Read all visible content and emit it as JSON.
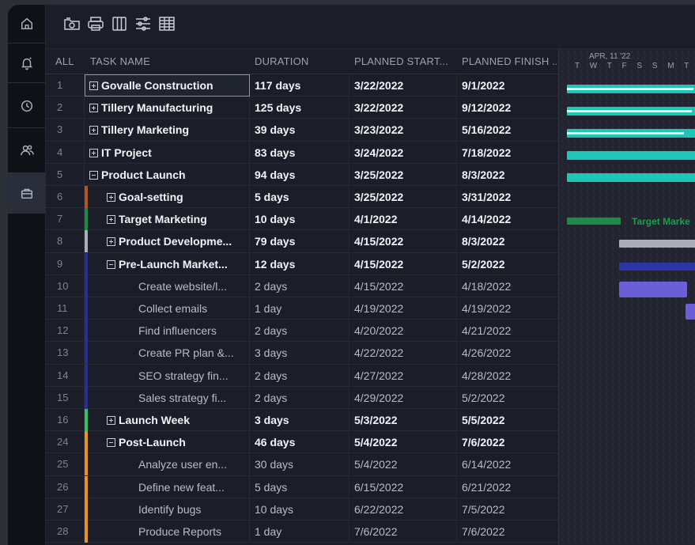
{
  "toolbar": {
    "icons": [
      "folder-image-icon",
      "print-icon",
      "columns-icon",
      "filter-sliders-icon",
      "table-grid-icon"
    ]
  },
  "sidebar": {
    "items": [
      "home-icon",
      "notification-bell-icon",
      "clock-icon",
      "team-icon",
      "briefcase-icon"
    ]
  },
  "columns": {
    "all": "ALL",
    "task": "TASK NAME",
    "duration": "DURATION",
    "start": "PLANNED START...",
    "finish": "PLANNED FINISH ..."
  },
  "gantt": {
    "week_label": "APR, 11 '22",
    "days": "T W T F S S M T",
    "bar_label": "Target Marke"
  },
  "rows": [
    {
      "num": "1",
      "name": "Govalle Construction",
      "duration": "117 days",
      "start": "3/22/2022",
      "finish": "9/1/2022",
      "bold": true,
      "toggle": "plus",
      "indent": 0,
      "color": "",
      "selected": true
    },
    {
      "num": "2",
      "name": "Tillery Manufacturing",
      "duration": "125 days",
      "start": "3/22/2022",
      "finish": "9/12/2022",
      "bold": true,
      "toggle": "plus",
      "indent": 0,
      "color": ""
    },
    {
      "num": "3",
      "name": "Tillery Marketing",
      "duration": "39 days",
      "start": "3/23/2022",
      "finish": "5/16/2022",
      "bold": true,
      "toggle": "plus",
      "indent": 0,
      "color": ""
    },
    {
      "num": "4",
      "name": "IT Project",
      "duration": "83 days",
      "start": "3/24/2022",
      "finish": "7/18/2022",
      "bold": true,
      "toggle": "plus",
      "indent": 0,
      "color": ""
    },
    {
      "num": "5",
      "name": "Product Launch",
      "duration": "94 days",
      "start": "3/25/2022",
      "finish": "8/3/2022",
      "bold": true,
      "toggle": "minus",
      "indent": 0,
      "color": ""
    },
    {
      "num": "6",
      "name": "Goal-setting",
      "duration": "5 days",
      "start": "3/25/2022",
      "finish": "3/31/2022",
      "bold": true,
      "toggle": "plus",
      "indent": 1,
      "color": "#b4571f"
    },
    {
      "num": "7",
      "name": "Target Marketing",
      "duration": "10 days",
      "start": "4/1/2022",
      "finish": "4/14/2022",
      "bold": true,
      "toggle": "plus",
      "indent": 1,
      "color": "#1f8a47"
    },
    {
      "num": "8",
      "name": "Product Developme...",
      "duration": "79 days",
      "start": "4/15/2022",
      "finish": "8/3/2022",
      "bold": true,
      "toggle": "plus",
      "indent": 1,
      "color": "#a8adb8"
    },
    {
      "num": "9",
      "name": "Pre-Launch Market...",
      "duration": "12 days",
      "start": "4/15/2022",
      "finish": "5/2/2022",
      "bold": true,
      "toggle": "minus",
      "indent": 1,
      "color": "#2a2f8f"
    },
    {
      "num": "10",
      "name": "Create website/l...",
      "duration": "2 days",
      "start": "4/15/2022",
      "finish": "4/18/2022",
      "bold": false,
      "toggle": "",
      "indent": 2,
      "color": "#2a2f8f"
    },
    {
      "num": "11",
      "name": "Collect emails",
      "duration": "1 day",
      "start": "4/19/2022",
      "finish": "4/19/2022",
      "bold": false,
      "toggle": "",
      "indent": 2,
      "color": "#2a2f8f"
    },
    {
      "num": "12",
      "name": "Find influencers",
      "duration": "2 days",
      "start": "4/20/2022",
      "finish": "4/21/2022",
      "bold": false,
      "toggle": "",
      "indent": 2,
      "color": "#2a2f8f"
    },
    {
      "num": "13",
      "name": "Create PR plan &...",
      "duration": "3 days",
      "start": "4/22/2022",
      "finish": "4/26/2022",
      "bold": false,
      "toggle": "",
      "indent": 2,
      "color": "#2a2f8f"
    },
    {
      "num": "14",
      "name": "SEO strategy fin...",
      "duration": "2 days",
      "start": "4/27/2022",
      "finish": "4/28/2022",
      "bold": false,
      "toggle": "",
      "indent": 2,
      "color": "#2a2f8f"
    },
    {
      "num": "15",
      "name": "Sales strategy fi...",
      "duration": "2 days",
      "start": "4/29/2022",
      "finish": "5/2/2022",
      "bold": false,
      "toggle": "",
      "indent": 2,
      "color": "#2a2f8f"
    },
    {
      "num": "16",
      "name": "Launch Week",
      "duration": "3 days",
      "start": "5/3/2022",
      "finish": "5/5/2022",
      "bold": true,
      "toggle": "plus",
      "indent": 1,
      "color": "#3bbf63"
    },
    {
      "num": "24",
      "name": "Post-Launch",
      "duration": "46 days",
      "start": "5/4/2022",
      "finish": "7/6/2022",
      "bold": true,
      "toggle": "minus",
      "indent": 1,
      "color": "#e8922b"
    },
    {
      "num": "25",
      "name": "Analyze user en...",
      "duration": "30 days",
      "start": "5/4/2022",
      "finish": "6/14/2022",
      "bold": false,
      "toggle": "",
      "indent": 2,
      "color": "#e8922b"
    },
    {
      "num": "26",
      "name": "Define new feat...",
      "duration": "5 days",
      "start": "6/15/2022",
      "finish": "6/21/2022",
      "bold": false,
      "toggle": "",
      "indent": 2,
      "color": "#e8922b"
    },
    {
      "num": "27",
      "name": "Identify bugs",
      "duration": "10 days",
      "start": "6/22/2022",
      "finish": "7/5/2022",
      "bold": false,
      "toggle": "",
      "indent": 2,
      "color": "#e8922b"
    },
    {
      "num": "28",
      "name": "Produce Reports",
      "duration": "1 day",
      "start": "7/6/2022",
      "finish": "7/6/2022",
      "bold": false,
      "toggle": "",
      "indent": 2,
      "color": "#e8922b"
    }
  ],
  "colors": {
    "teal": "#1ec6b8",
    "green": "#1f8a47",
    "gray": "#a8adb8",
    "navy": "#2a2f8f",
    "violet": "#6a5fd8"
  }
}
